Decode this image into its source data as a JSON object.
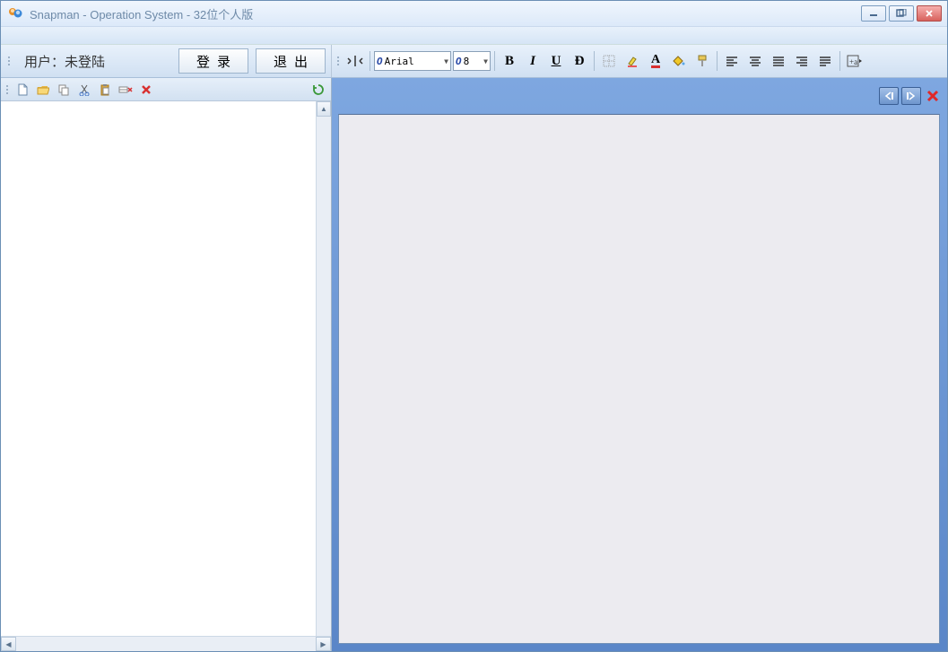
{
  "window": {
    "title": "Snapman - Operation System - 32位个人版"
  },
  "user": {
    "label": "用户：未登陆",
    "login_btn": "登录",
    "logout_btn": "退出"
  },
  "format": {
    "font_name": "Arial",
    "font_size": "8"
  }
}
